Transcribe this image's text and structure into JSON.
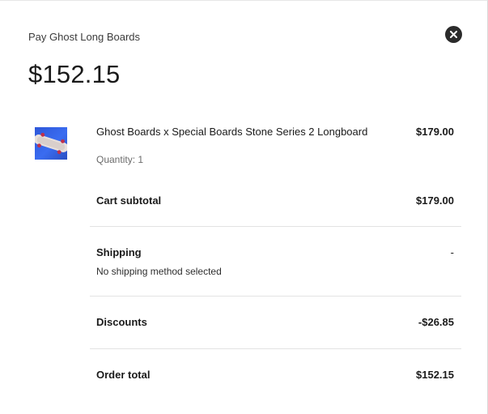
{
  "header": {
    "title": "Pay Ghost Long Boards",
    "close_icon": "close-icon"
  },
  "amount_due": "$152.15",
  "line_item": {
    "name": "Ghost Boards x Special Boards Stone Series 2 Longboard",
    "price": "$179.00",
    "quantity_label": "Quantity: 1",
    "thumbnail_icon": "longboard-image"
  },
  "summary": {
    "subtotal_label": "Cart subtotal",
    "subtotal_value": "$179.00",
    "shipping_label": "Shipping",
    "shipping_value": "-",
    "shipping_note": "No shipping method selected",
    "discounts_label": "Discounts",
    "discounts_value": "-$26.85",
    "total_label": "Order total",
    "total_value": "$152.15"
  },
  "colors": {
    "close_button_bg": "#2b2b2b",
    "thumbnail_bg": "#3a6cf0",
    "divider": "#e3e3e3"
  }
}
